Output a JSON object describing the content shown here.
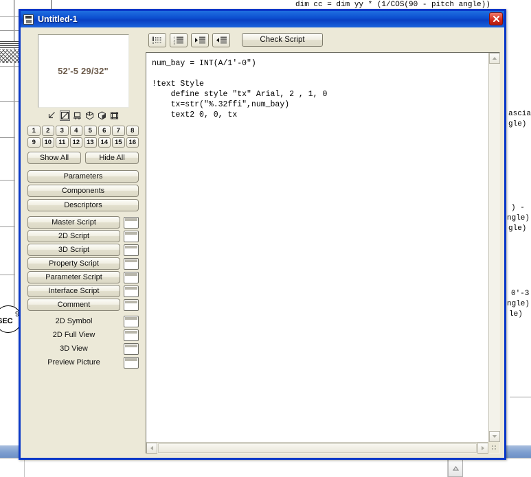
{
  "window": {
    "title": "Untitled-1",
    "icon": "script-document-icon",
    "close_label": "Close"
  },
  "preview": {
    "dimension_text": "52'-5 29/32\"",
    "view_icons": [
      {
        "name": "2d-line-view-icon",
        "selected": false
      },
      {
        "name": "2d-symbol-view-icon",
        "selected": true
      },
      {
        "name": "2d-full-view-icon",
        "selected": false
      },
      {
        "name": "3d-wireframe-view-icon",
        "selected": false
      },
      {
        "name": "3d-solid-view-icon",
        "selected": false
      },
      {
        "name": "preview-picture-icon",
        "selected": false
      }
    ]
  },
  "layer_buttons": [
    "1",
    "2",
    "3",
    "4",
    "5",
    "6",
    "7",
    "8",
    "9",
    "10",
    "11",
    "12",
    "13",
    "14",
    "15",
    "16"
  ],
  "visibility": {
    "show_all": "Show All",
    "hide_all": "Hide All"
  },
  "data_buttons": [
    "Parameters",
    "Components",
    "Descriptors"
  ],
  "script_buttons": [
    "Master Script",
    "2D Script",
    "3D Script",
    "Property Script",
    "Parameter Script",
    "Interface Script",
    "Comment"
  ],
  "view_labels": [
    "2D Symbol",
    "2D Full View",
    "3D View",
    "Preview Picture"
  ],
  "toolbar": {
    "buttons": [
      {
        "name": "insert-bitmap-icon",
        "label": "Insert Bitmap"
      },
      {
        "name": "line-numbers-icon",
        "label": "Line Numbers"
      },
      {
        "name": "indent-right-icon",
        "label": "Indent Right"
      },
      {
        "name": "indent-left-icon",
        "label": "Indent Left"
      }
    ],
    "check_script": "Check Script"
  },
  "editor": {
    "code": "num_bay = INT(A/1'-0\")\n\n!text Style\n    define style \"tx\" Arial, 2 , 1, 0\n    tx=str(\"%.32ffi\",num_bay)\n    text2 0, 0, tx"
  },
  "background": {
    "top_formula": "dim cc = dim yy * (1/COS(90 - pitch angle))",
    "right_fragments": [
      "ascia",
      "gle)",
      ") -",
      "ngle)",
      "gle)",
      "0'-3",
      "ngle)",
      "le)"
    ],
    "section_marker": "SEC",
    "section_number": "9"
  },
  "colors": {
    "title_bar": "#0c4fd0",
    "window_border": "#0a38c8",
    "panel_face": "#ece9d8",
    "close_button": "#d22b1c",
    "preview_text": "#6b5a4a",
    "editor_bg": "#ffffff",
    "taskbar": "#7e9fd0"
  }
}
